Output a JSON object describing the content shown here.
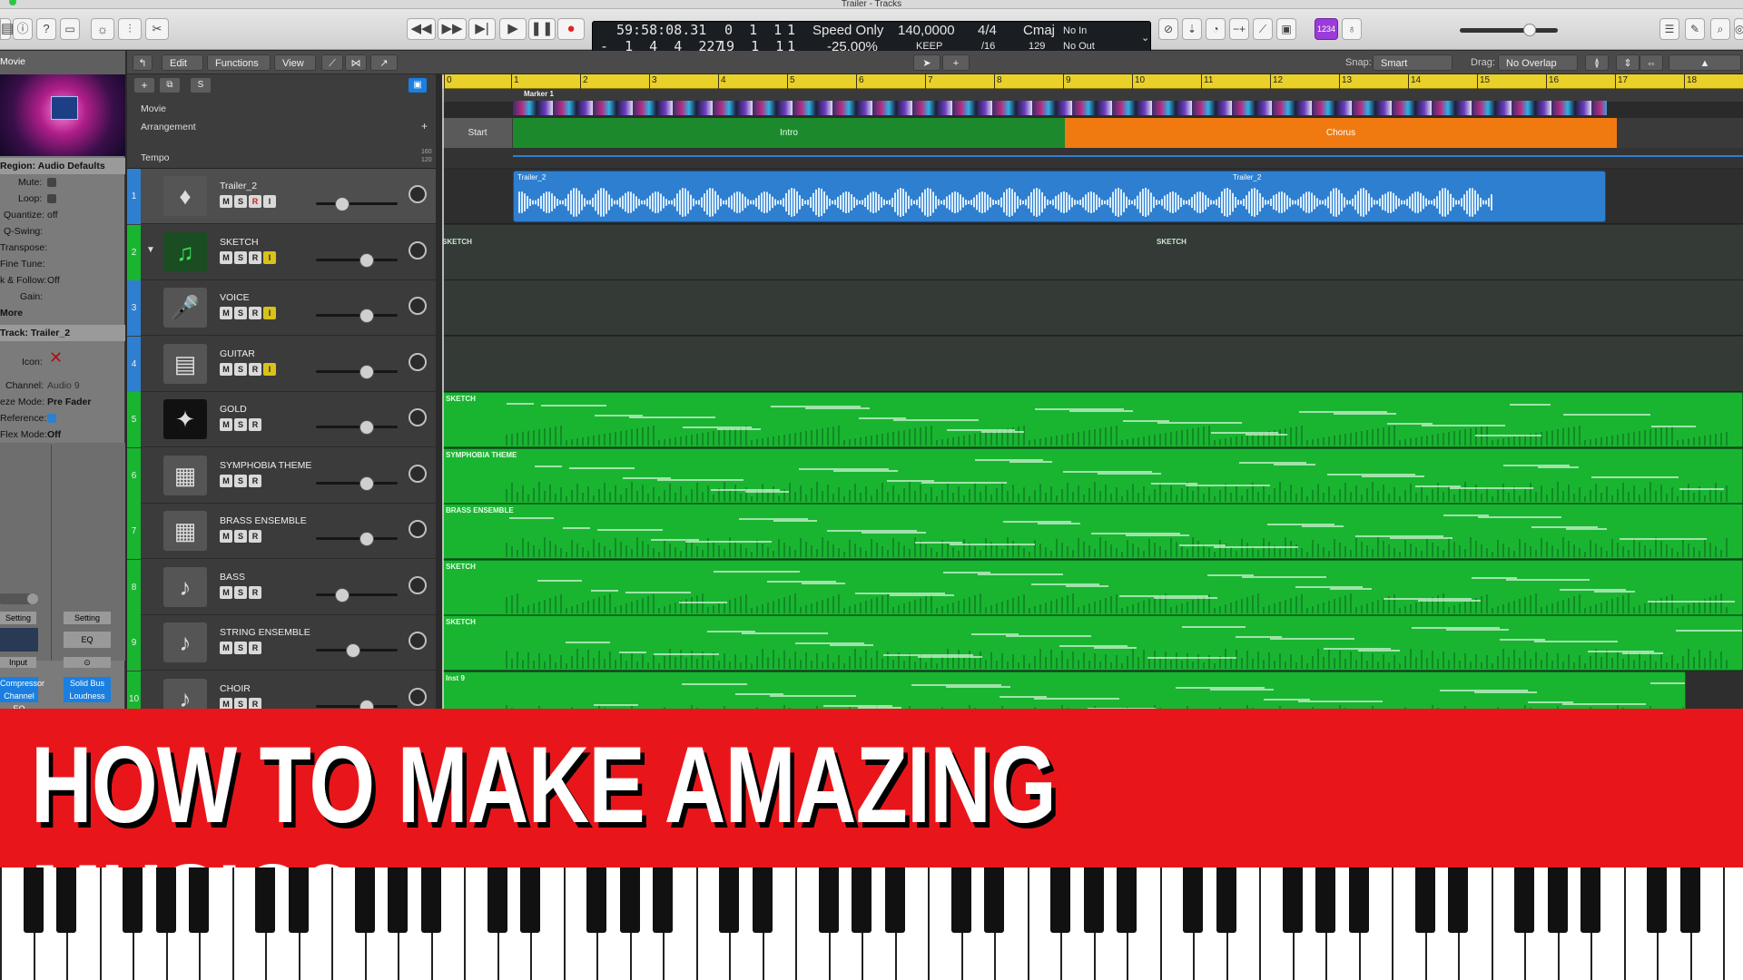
{
  "window": {
    "title": "Trailer - Tracks"
  },
  "transport": {
    "position_time": "59:58:08.31",
    "position_bars_top": "0  1  1",
    "position_bars_top_last": "1",
    "position_time_sub": "-  1  4  4  227",
    "position_bars_sub": "19  1  1",
    "position_bars_sub_last": "1",
    "speed_label": "Speed Only",
    "speed_value": "-25,00%",
    "tempo": "140,0000",
    "tempo_mode": "KEEP",
    "signature": "4/4",
    "division": "/16",
    "key": "Cmaj",
    "key_sub": "129",
    "in": "No In",
    "out": "No Out",
    "badge": "1234"
  },
  "localbar": {
    "edit": "Edit",
    "functions": "Functions",
    "view": "View",
    "snap_label": "Snap:",
    "snap_value": "Smart",
    "drag_label": "Drag:",
    "drag_value": "No Overlap"
  },
  "inspector": {
    "movie_label": "Movie",
    "region_header": "Region: Audio Defaults",
    "mute": "Mute:",
    "loop": "Loop:",
    "quantize": "Quantize:",
    "quantize_value": "off",
    "qswing": "Q-Swing:",
    "transpose": "Transpose:",
    "finetune": "Fine Tune:",
    "follow": "k & Follow:",
    "follow_value": "Off",
    "gain": "Gain:",
    "more": "More",
    "track_header": "Track: Trailer_2",
    "icon": "Icon:",
    "channel": "Channel:",
    "channel_value": "Audio 9",
    "freeze": "eze Mode:",
    "freeze_value": "Pre Fader",
    "reference": "Reference:",
    "flex": "Flex Mode:",
    "flex_value": "Off",
    "setting1": "Setting",
    "setting2": "Setting",
    "eq": "EQ",
    "input": "Input",
    "compressor": "Compressor",
    "channel_eq": "Channel EQ",
    "solid_bus": "Solid Bus",
    "loudness": "Loudness"
  },
  "global_tracks": {
    "movie": "Movie",
    "arrangement": "Arrangement",
    "tempo": "Tempo",
    "marker": "Marker 1",
    "arr_start": "Start",
    "arr_intro": "Intro",
    "arr_chorus": "Chorus",
    "tempo_hi": "160",
    "tempo_lo": "120"
  },
  "ruler": [
    "1",
    "2",
    "3",
    "4",
    "5",
    "6",
    "7",
    "8",
    "9",
    "10",
    "11",
    "12",
    "13",
    "14",
    "15",
    "16",
    "17",
    "18"
  ],
  "ruler_zero": "0",
  "tracks": [
    {
      "num": "1",
      "name": "Trailer_2",
      "icon": "♦",
      "color": "#2f7fd0",
      "btn_r": "R",
      "btn_i": "I"
    },
    {
      "num": "2",
      "name": "SKETCH",
      "icon": "♫",
      "color": "#19b531",
      "btn_r": "R",
      "btn_i": "I"
    },
    {
      "num": "3",
      "name": "VOICE",
      "icon": "🎤",
      "color": "#2f7fd0",
      "btn_r": "R",
      "btn_i": "I"
    },
    {
      "num": "4",
      "name": "GUITAR",
      "icon": "▤",
      "color": "#2f7fd0",
      "btn_r": "R",
      "btn_i": "I"
    },
    {
      "num": "5",
      "name": "GOLD",
      "icon": "✦",
      "color": "#19b531",
      "btn_r": "R",
      "btn_i": ""
    },
    {
      "num": "6",
      "name": "SYMPHOBIA THEME",
      "icon": "▦",
      "color": "#19b531",
      "btn_r": "R",
      "btn_i": ""
    },
    {
      "num": "7",
      "name": "BRASS ENSEMBLE",
      "icon": "▦",
      "color": "#19b531",
      "btn_r": "R",
      "btn_i": ""
    },
    {
      "num": "8",
      "name": "BASS",
      "icon": "♪",
      "color": "#19b531",
      "btn_r": "R",
      "btn_i": ""
    },
    {
      "num": "9",
      "name": "STRING ENSEMBLE",
      "icon": "♪",
      "color": "#19b531",
      "btn_r": "R",
      "btn_i": ""
    },
    {
      "num": "10",
      "name": "CHOIR",
      "icon": "♪",
      "color": "#19b531",
      "btn_r": "R",
      "btn_i": ""
    }
  ],
  "regions": {
    "audio_label_1": "Trailer_2",
    "audio_label_2": "Trailer_2",
    "sketch_1": "SKETCH",
    "sketch_2": "SKETCH",
    "midi": [
      "SKETCH",
      "SYMPHOBIA THEME",
      "BRASS ENSEMBLE",
      "SKETCH",
      "SKETCH",
      "Inst 9"
    ]
  },
  "banner": {
    "text": "HOW TO MAKE AMAZING MUSIC?"
  },
  "colors": {
    "banner": "#e8161a",
    "midi_region": "#19b531",
    "audio_region": "#2f7fd0",
    "ruler": "#e9d12a",
    "intro": "#1c8a2c",
    "chorus": "#f07a10"
  }
}
